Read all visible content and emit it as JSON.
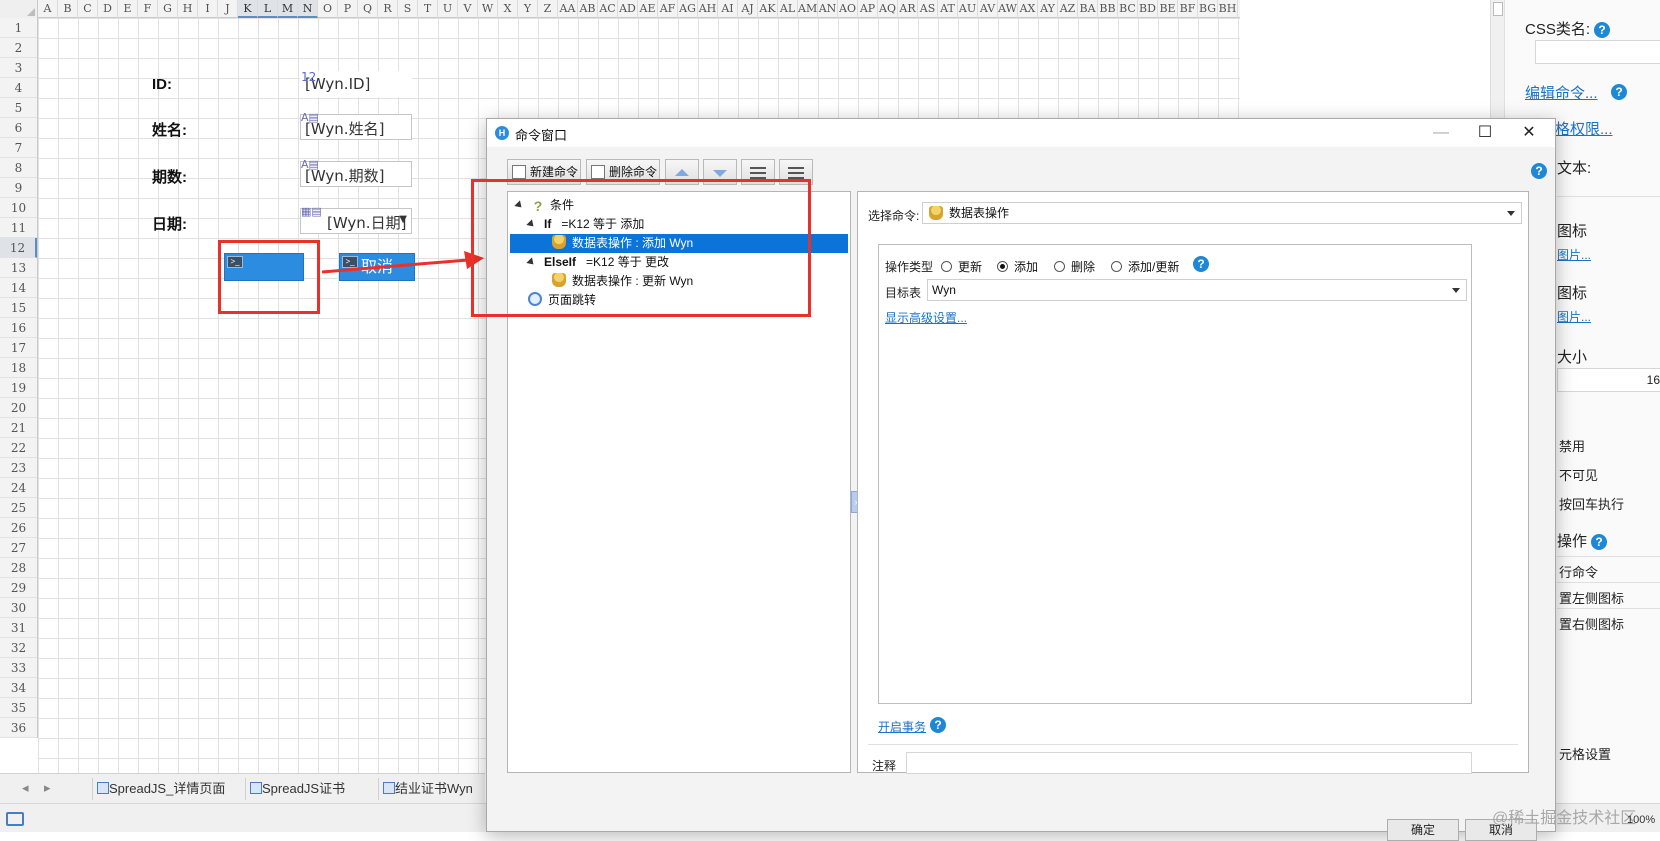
{
  "sheet": {
    "columns": [
      "A",
      "B",
      "C",
      "D",
      "E",
      "F",
      "G",
      "H",
      "I",
      "J",
      "K",
      "L",
      "M",
      "N",
      "O",
      "P",
      "Q",
      "R",
      "S",
      "T",
      "U",
      "V",
      "W",
      "X",
      "Y",
      "Z",
      "AA",
      "AB",
      "AC",
      "AD",
      "AE",
      "AF",
      "AG",
      "AH",
      "AI",
      "AJ",
      "AK",
      "AL",
      "AM",
      "AN",
      "AO",
      "AP",
      "AQ",
      "AR",
      "AS",
      "AT",
      "AU",
      "AV",
      "AW",
      "AX",
      "AY",
      "AZ",
      "BA",
      "BB",
      "BC",
      "BD",
      "BE",
      "BF",
      "BG",
      "BH"
    ],
    "selected_columns": [
      "K",
      "L",
      "M",
      "N"
    ],
    "rows": [
      "1",
      "2",
      "3",
      "4",
      "5",
      "6",
      "7",
      "8",
      "9",
      "10",
      "11",
      "12",
      "13",
      "14",
      "15",
      "16",
      "17",
      "18",
      "19",
      "20",
      "21",
      "22",
      "23",
      "24",
      "25",
      "26",
      "27",
      "28",
      "29",
      "30",
      "31",
      "32",
      "33",
      "34",
      "35",
      "36"
    ],
    "selected_row": "12",
    "form": {
      "id_label": "ID:",
      "id_value": "[Wyn.ID]",
      "id_badge": "12",
      "name_label": "姓名:",
      "name_value": "[Wyn.姓名]",
      "period_label": "期数:",
      "period_value": "[Wyn.期数]",
      "date_label": "日期:",
      "date_value": "[Wyn.日期]",
      "cancel_button": "取消"
    },
    "tabs": [
      "SpreadJS_详情页面",
      "SpreadJS证书",
      "结业证书Wyn"
    ],
    "accent_color": "#2b8ce0",
    "highlight_color": "#e8312a"
  },
  "right_panel": {
    "css_class_label": "CSS类名:",
    "edit_command_link": "编辑命令...",
    "permission_link": "格权限...",
    "text_label": "文本:",
    "icon1_label": "图标",
    "icon1_link": "图片...",
    "icon2_label": "图标",
    "icon2_link": "图片...",
    "size_label": "大小",
    "size_value": "16",
    "option1": "禁用",
    "option2": "不可见",
    "option3": "按回车执行",
    "operation_label": "操作",
    "op_item1": "行命令",
    "op_item2": "置左侧图标",
    "op_item3": "置右侧图标",
    "cell_settings": "元格设置"
  },
  "dialog": {
    "title": "命令窗口",
    "toolbar": {
      "new_command": "新建命令",
      "delete_command": "删除命令"
    },
    "tree": {
      "condition_label": "条件",
      "if_keyword": "If",
      "if_condition": "=K12 等于 添加",
      "if_child": "数据表操作 : 添加 Wyn",
      "elseif_keyword": "ElseIf",
      "elseif_condition": "=K12 等于 更改",
      "elseif_child": "数据表操作 : 更新 Wyn",
      "page_jump": "页面跳转"
    },
    "editor": {
      "select_command_label": "选择命令:",
      "select_command_value": "数据表操作",
      "operation_type_label": "操作类型",
      "op_update": "更新",
      "op_add": "添加",
      "op_delete": "删除",
      "op_add_update": "添加/更新",
      "selected_op": "添加",
      "target_table_label": "目标表",
      "target_table_value": "Wyn",
      "advanced_link": "显示高级设置...",
      "transaction_link": "开启事务",
      "note_label": "注释",
      "note_value": ""
    },
    "ok_button": "确定",
    "cancel_button": "取消"
  },
  "watermark": "@稀土掘金技术社区",
  "zoom": "100%"
}
